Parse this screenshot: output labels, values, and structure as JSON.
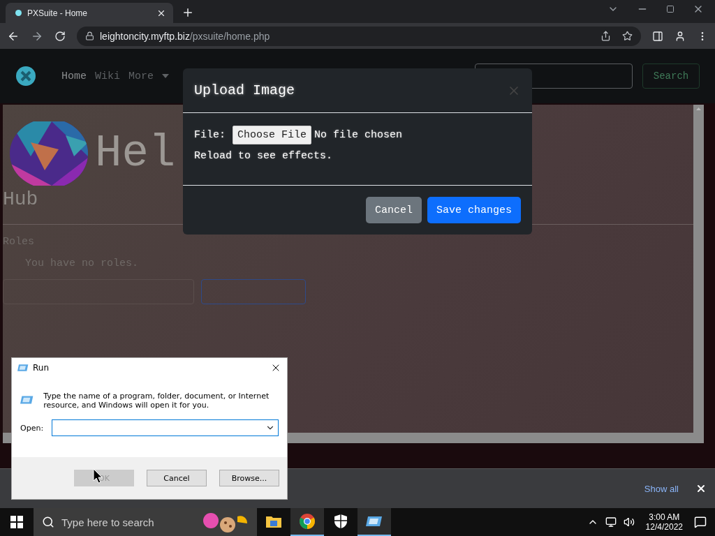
{
  "browser": {
    "tab": {
      "title": "PXSuite - Home",
      "selected": true
    },
    "url_host": "leightoncity.myftp.biz",
    "url_path": "/pxsuite/home.php"
  },
  "site": {
    "nav": [
      {
        "label": "Home",
        "selected": true
      },
      {
        "label": "Wiki",
        "selected": false
      },
      {
        "label": "More",
        "selected": false
      }
    ],
    "search_button": "Search"
  },
  "content": {
    "heading_start": "Hel",
    "heading_line2": "Hub",
    "roles_title": "Roles",
    "roles_text": "You have no roles.",
    "buttons": [
      {
        "kind": "secondary"
      },
      {
        "kind": "primary"
      }
    ]
  },
  "modal": {
    "title": "Upload Image",
    "file_label": "File:",
    "choose_button": "Choose File",
    "file_status": "No file chosen",
    "note": "Reload to see effects.",
    "buttons": [
      {
        "label": "Cancel",
        "kind": "secondary"
      },
      {
        "label": "Save changes",
        "kind": "primary"
      }
    ]
  },
  "run_dialog": {
    "title": "Run",
    "message": "Type the name of a program, folder, document, or Internet resource, and Windows will open it for you.",
    "open_label": "Open:",
    "buttons": [
      {
        "label": "OK",
        "disabled": true
      },
      {
        "label": "Cancel",
        "disabled": false
      },
      {
        "label": "Browse...",
        "disabled": false
      }
    ]
  },
  "downloads_bar": {
    "show_all": "Show all"
  },
  "taskbar": {
    "search_placeholder": "Type here to search",
    "apps": [
      {
        "kind": "explorer",
        "selected": false
      },
      {
        "kind": "chrome",
        "selected": true
      },
      {
        "kind": "security",
        "selected": false
      },
      {
        "kind": "run",
        "selected": true
      }
    ],
    "time": "3:00 AM",
    "date": "12/4/2022"
  }
}
